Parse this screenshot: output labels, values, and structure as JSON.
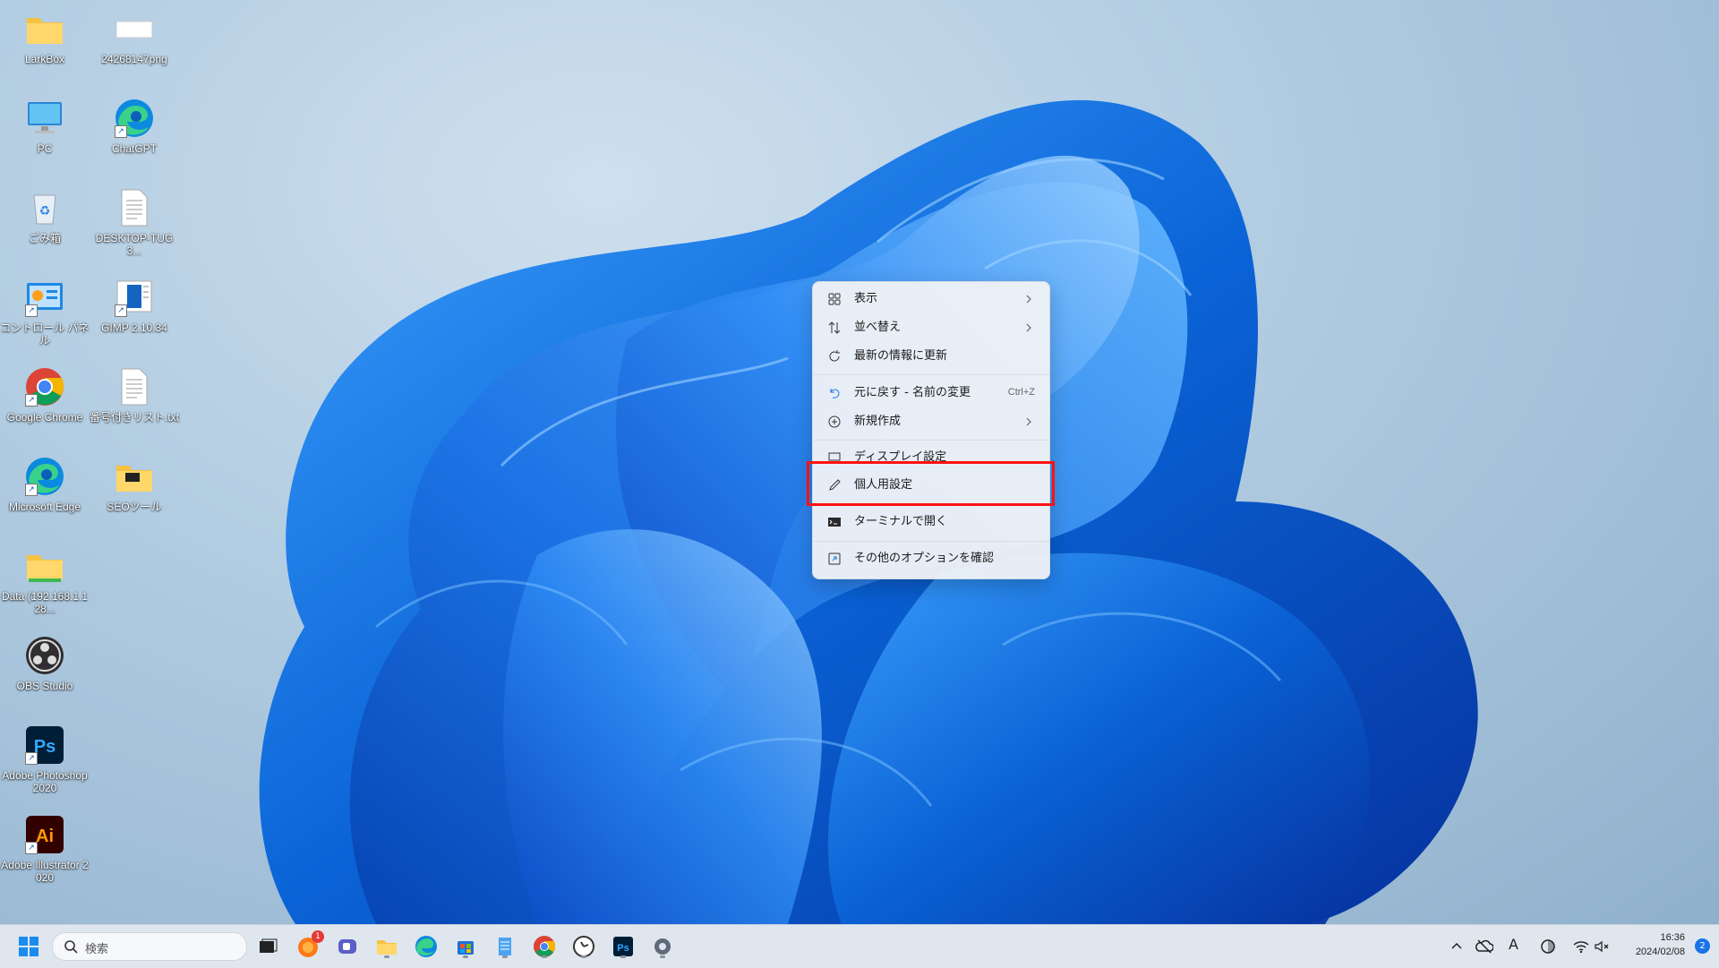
{
  "desktop_icons": [
    {
      "label": "LarkBox",
      "icon": "folder-icon"
    },
    {
      "label": "24268147png",
      "icon": "image-file-icon"
    },
    {
      "label": "PC",
      "icon": "monitor-icon"
    },
    {
      "label": "ChatGPT",
      "icon": "edge-icon"
    },
    {
      "label": "ごみ箱",
      "icon": "recycle-bin-icon"
    },
    {
      "label": "DESKTOP-TUG3...",
      "icon": "text-file-icon"
    },
    {
      "label": "コントロール パネル",
      "icon": "control-panel-icon"
    },
    {
      "label": "GIMP 2.10.34",
      "icon": "gimp-icon"
    },
    {
      "label": "Google Chrome",
      "icon": "chrome-icon"
    },
    {
      "label": "番号付きリスト.txt",
      "icon": "text-file-icon"
    },
    {
      "label": "Microsoft Edge",
      "icon": "edge-icon"
    },
    {
      "label": "SEOツール",
      "icon": "folder-icon"
    },
    {
      "label": "Data (192.168.1.128...",
      "icon": "network-folder-icon"
    },
    {
      "label": "OBS Studio",
      "icon": "obs-icon"
    },
    {
      "label": "Adobe Photoshop 2020",
      "icon": "photoshop-icon"
    },
    {
      "label": "Adobe Illustrator 2020",
      "icon": "illustrator-icon"
    }
  ],
  "context_menu": {
    "items": [
      {
        "label": "表示",
        "icon": "grid-icon",
        "submenu": true
      },
      {
        "label": "並べ替え",
        "icon": "sort-icon",
        "submenu": true
      },
      {
        "label": "最新の情報に更新",
        "icon": "refresh-icon"
      },
      {
        "label": "元に戻す - 名前の変更",
        "icon": "undo-icon",
        "shortcut": "Ctrl+Z"
      },
      {
        "label": "新規作成",
        "icon": "new-plus-icon",
        "submenu": true
      },
      {
        "label": "ディスプレイ設定",
        "icon": "display-icon"
      },
      {
        "label": "個人用設定",
        "icon": "brush-icon",
        "highlighted": true
      },
      {
        "label": "ターミナルで開く",
        "icon": "terminal-icon"
      },
      {
        "label": "その他のオプションを確認",
        "icon": "more-options-icon"
      }
    ]
  },
  "taskbar": {
    "search_placeholder": "検索",
    "pinned": [
      "widgets-icon",
      "firefox-icon",
      "teams-icon",
      "file-explorer-icon",
      "edge-icon",
      "store-icon",
      "notepad-icon",
      "chrome-icon",
      "clock-app-icon",
      "photoshop-icon",
      "settings-icon"
    ],
    "badge": "1",
    "tray_ime": "A",
    "time": "16:36",
    "date": "2024/02/08",
    "notification_count": "2"
  },
  "colors": {
    "highlight_border": "#ff1212",
    "accent": "#0a63d6"
  }
}
